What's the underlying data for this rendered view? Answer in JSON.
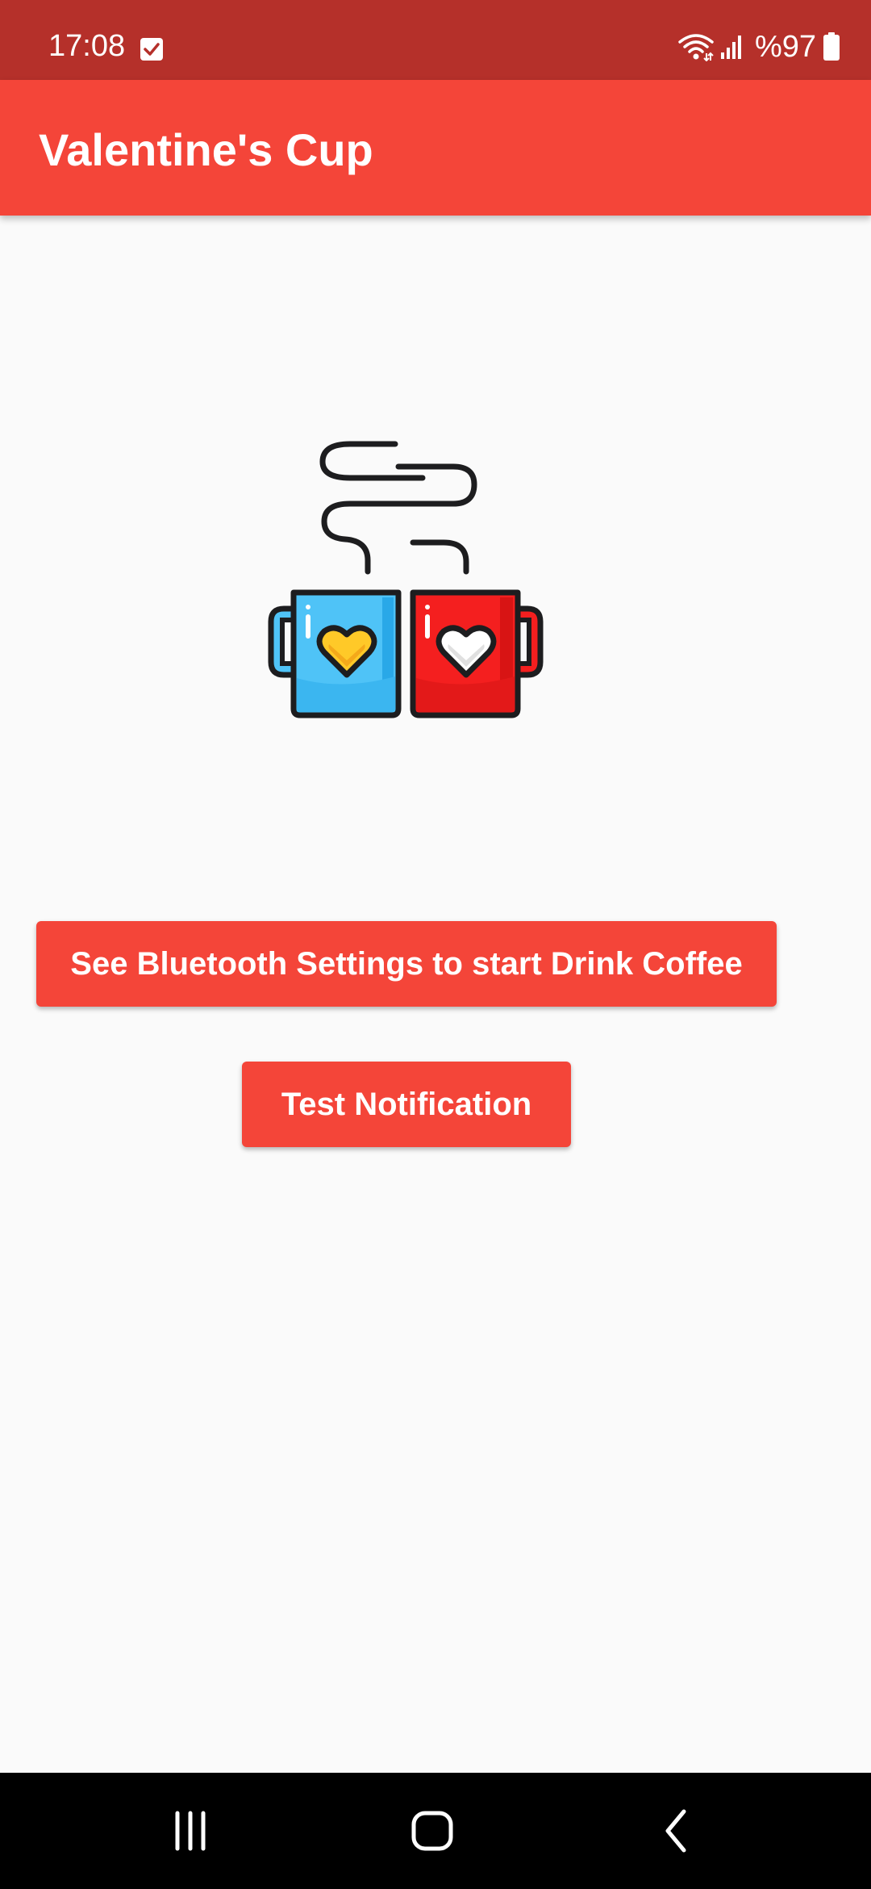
{
  "status_bar": {
    "time": "17:08",
    "battery_text": "%97",
    "icons": [
      "checkbox-notification-icon",
      "wifi-icon",
      "signal-icon",
      "battery-icon"
    ]
  },
  "app_bar": {
    "title": "Valentine's Cup"
  },
  "main": {
    "illustration_icon": "two-coffee-mugs-with-hearts-icon",
    "bluetooth_button_label": "See Bluetooth Settings to start Drink Coffee",
    "test_button_label": "Test Notification"
  },
  "nav_bar": {
    "icons": [
      "recents-icon",
      "home-icon",
      "back-icon"
    ]
  },
  "colors": {
    "status_bar": "#b5302a",
    "primary": "#f44539",
    "background": "#fafafa",
    "mug_blue": "#4fc3f7",
    "mug_red": "#f41f1f",
    "heart_yellow": "#ffc928"
  }
}
